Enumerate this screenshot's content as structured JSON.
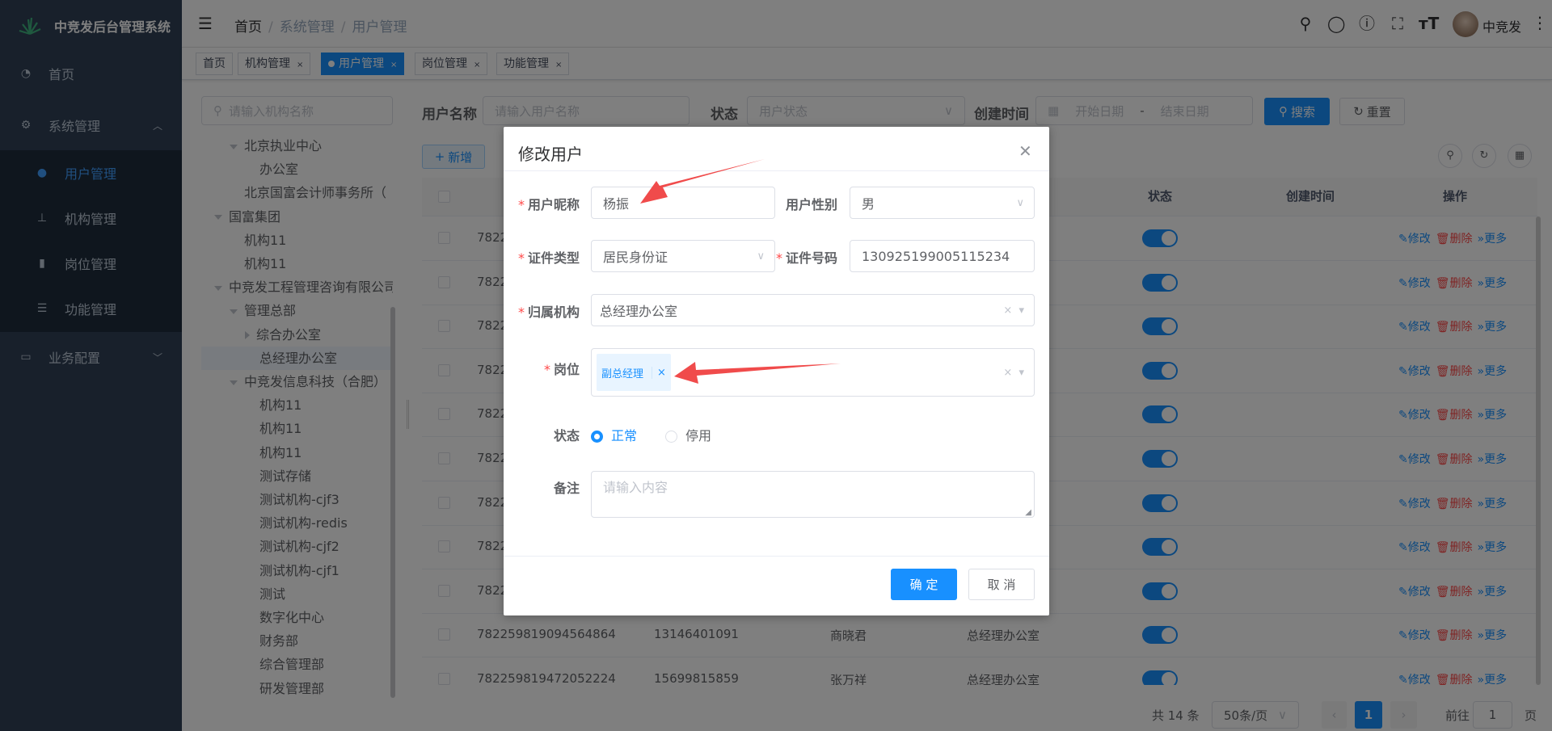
{
  "app": {
    "title": "中竞发后台管理系统"
  },
  "sidebar": {
    "items": [
      {
        "label": "首页",
        "icon": "dashboard-icon"
      },
      {
        "label": "系统管理",
        "icon": "gear-icon",
        "expanded": true,
        "children": [
          {
            "label": "用户管理",
            "icon": "user-icon",
            "active": true
          },
          {
            "label": "机构管理",
            "icon": "org-tree-icon"
          },
          {
            "label": "岗位管理",
            "icon": "post-icon"
          },
          {
            "label": "功能管理",
            "icon": "function-list-icon"
          }
        ]
      },
      {
        "label": "业务配置",
        "icon": "briefcase-icon"
      }
    ]
  },
  "header": {
    "breadcrumb": [
      "首页",
      "系统管理",
      "用户管理"
    ],
    "user": "中竞发",
    "icons": [
      "search-icon",
      "github-icon",
      "help-icon",
      "fullscreen-icon",
      "font-size-icon"
    ]
  },
  "tags": [
    {
      "label": "首页"
    },
    {
      "label": "机构管理"
    },
    {
      "label": "用户管理",
      "active": true
    },
    {
      "label": "岗位管理"
    },
    {
      "label": "功能管理"
    }
  ],
  "tree": {
    "search_placeholder": "请输入机构名称",
    "nodes": [
      {
        "label": "北京执业中心",
        "level": 2,
        "state": "open"
      },
      {
        "label": "办公室",
        "level": 3
      },
      {
        "label": "北京国富会计师事务所（",
        "level": 2
      },
      {
        "label": "国富集团",
        "level": 1,
        "state": "open"
      },
      {
        "label": "机构11",
        "level": 2
      },
      {
        "label": "机构11",
        "level": 2
      },
      {
        "label": "中竞发工程管理咨询有限公司",
        "level": 1,
        "state": "open"
      },
      {
        "label": "管理总部",
        "level": 2,
        "state": "open"
      },
      {
        "label": "综合办公室",
        "level": 3,
        "state": "closed"
      },
      {
        "label": "总经理办公室",
        "level": 3,
        "selected": true
      },
      {
        "label": "中竞发信息科技（合肥）",
        "level": 2,
        "state": "open"
      },
      {
        "label": "机构11",
        "level": 3
      },
      {
        "label": "机构11",
        "level": 3
      },
      {
        "label": "机构11",
        "level": 3
      },
      {
        "label": "测试存储",
        "level": 3
      },
      {
        "label": "测试机构-cjf3",
        "level": 3
      },
      {
        "label": "测试机构-redis",
        "level": 3
      },
      {
        "label": "测试机构-cjf2",
        "level": 3
      },
      {
        "label": "测试机构-cjf1",
        "level": 3
      },
      {
        "label": "测试",
        "level": 3
      },
      {
        "label": "数字化中心",
        "level": 3
      },
      {
        "label": "财务部",
        "level": 3
      },
      {
        "label": "综合管理部",
        "level": 3
      },
      {
        "label": "研发管理部",
        "level": 3
      }
    ]
  },
  "filters": {
    "username_label": "用户名称",
    "username_placeholder": "请输入用户名称",
    "status_label": "状态",
    "status_placeholder": "用户状态",
    "created_label": "创建时间",
    "start_placeholder": "开始日期",
    "date_sep": "-",
    "end_placeholder": "结束日期",
    "search": "搜索",
    "reset": "重置"
  },
  "toolbar": {
    "add": "新增"
  },
  "table": {
    "headers": {
      "status": "状态",
      "created": "创建时间",
      "actions": "操作"
    },
    "action_labels": {
      "edit": "修改",
      "delete": "删除",
      "more": "更多"
    },
    "rows": [
      {
        "id": "7822",
        "phone": "",
        "name": "",
        "org": "",
        "enabled": true
      },
      {
        "id": "7822",
        "phone": "",
        "name": "",
        "org": "",
        "enabled": true
      },
      {
        "id": "7822",
        "phone": "",
        "name": "",
        "org": "",
        "enabled": true
      },
      {
        "id": "7822",
        "phone": "",
        "name": "",
        "org": "",
        "enabled": true
      },
      {
        "id": "7822",
        "phone": "",
        "name": "",
        "org": "",
        "enabled": true
      },
      {
        "id": "7822",
        "phone": "",
        "name": "",
        "org": "",
        "enabled": true
      },
      {
        "id": "7822",
        "phone": "",
        "name": "",
        "org": "",
        "enabled": true
      },
      {
        "id": "7822",
        "phone": "",
        "name": "",
        "org": "",
        "enabled": true
      },
      {
        "id": "7822",
        "phone": "",
        "name": "",
        "org": "",
        "enabled": true
      },
      {
        "id": "782259819094564864",
        "phone": "13146401091",
        "name": "商晓君",
        "org": "总经理办公室",
        "enabled": true
      },
      {
        "id": "782259819472052224",
        "phone": "15699815859",
        "name": "张万祥",
        "org": "总经理办公室",
        "enabled": true
      }
    ]
  },
  "pagination": {
    "total": "共 14 条",
    "page_size": "50条/页",
    "current": "1",
    "goto_label": "前往",
    "goto_value": "1",
    "page_suffix": "页"
  },
  "dialog": {
    "title": "修改用户",
    "nickname_label": "用户昵称",
    "nickname": "杨振",
    "gender_label": "用户性别",
    "gender": "男",
    "id_type_label": "证件类型",
    "id_type": "居民身份证",
    "id_no_label": "证件号码",
    "id_no": "130925199005115234",
    "org_label": "归属机构",
    "org": "总经理办公室",
    "post_label": "岗位",
    "post_tag": "副总经理",
    "status_label": "状态",
    "status_options": [
      "正常",
      "停用"
    ],
    "status_selected": "正常",
    "remark_label": "备注",
    "remark_placeholder": "请输入内容",
    "confirm": "确 定",
    "cancel": "取 消"
  },
  "colors": {
    "primary": "#1890ff",
    "danger": "#ff4949",
    "sidebar": "#304156",
    "annotation_arrow": "#f04b4b"
  }
}
